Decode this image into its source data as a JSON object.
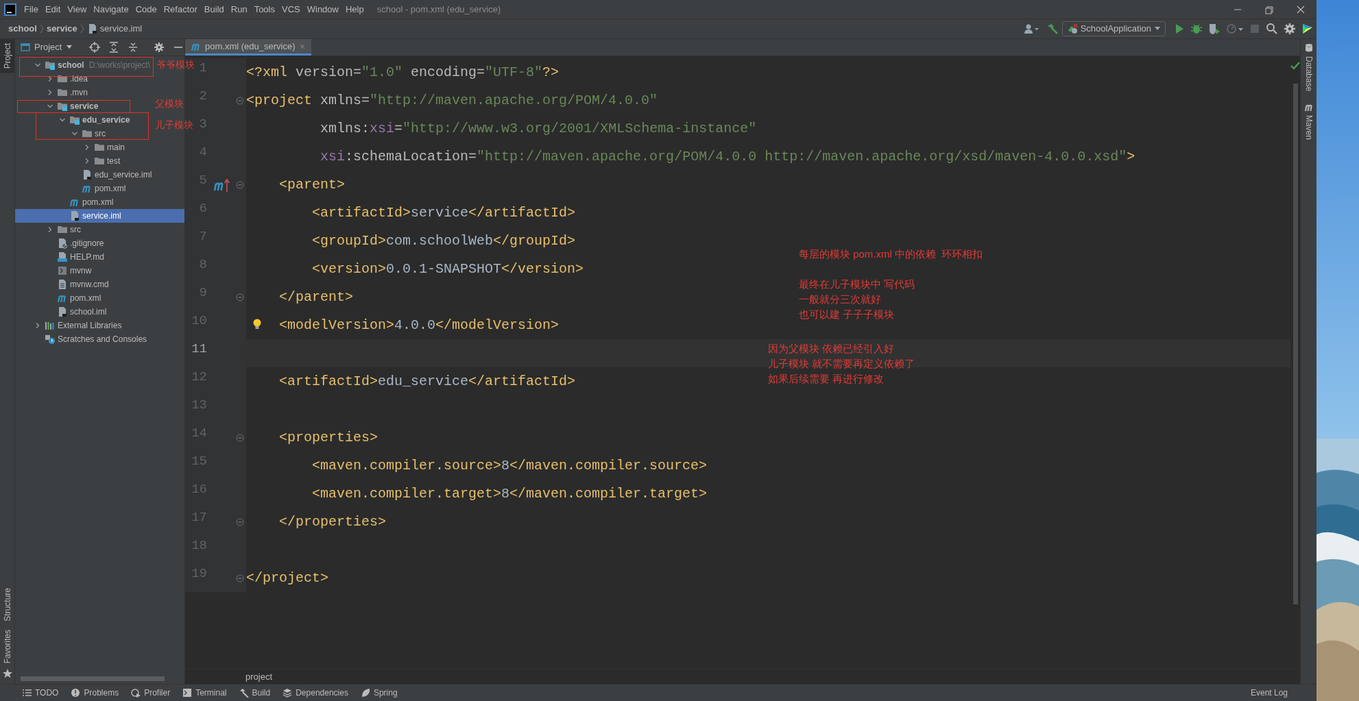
{
  "window": {
    "title": "school - pom.xml (edu_service)",
    "menu": [
      "File",
      "Edit",
      "View",
      "Navigate",
      "Code",
      "Refactor",
      "Build",
      "Run",
      "Tools",
      "VCS",
      "Window",
      "Help"
    ]
  },
  "breadcrumbs": [
    "school",
    "service",
    "service.iml"
  ],
  "toolbar": {
    "run_config": "SchoolApplication"
  },
  "left_stripe": [
    {
      "label": "Project",
      "selected": true
    },
    {
      "label": "Structure",
      "selected": false
    },
    {
      "label": "Favorites",
      "selected": false
    }
  ],
  "project_panel": {
    "title": "Project",
    "tree": [
      {
        "label": "school",
        "kind": "module",
        "bold": true,
        "hint": "D:\\works\\project\\",
        "expanded": true,
        "selected": false,
        "children": [
          {
            "label": ".idea",
            "kind": "folder",
            "bold": false,
            "expanded": false,
            "selected": false
          },
          {
            "label": ".mvn",
            "kind": "folder",
            "bold": false,
            "expanded": false,
            "selected": false
          },
          {
            "label": "service",
            "kind": "module",
            "bold": true,
            "expanded": true,
            "selected": false,
            "children": [
              {
                "label": "edu_service",
                "kind": "module",
                "bold": true,
                "expanded": true,
                "selected": false,
                "children": [
                  {
                    "label": "src",
                    "kind": "folder",
                    "bold": false,
                    "expanded": true,
                    "selected": false,
                    "children": [
                      {
                        "label": "main",
                        "kind": "folder",
                        "bold": false,
                        "expanded": false,
                        "selected": false
                      },
                      {
                        "label": "test",
                        "kind": "folder",
                        "bold": false,
                        "expanded": false,
                        "selected": false
                      }
                    ]
                  },
                  {
                    "label": "edu_service.iml",
                    "kind": "iml",
                    "bold": false,
                    "selected": false
                  },
                  {
                    "label": "pom.xml",
                    "kind": "maven",
                    "bold": false,
                    "selected": false
                  }
                ]
              },
              {
                "label": "pom.xml",
                "kind": "maven",
                "bold": false,
                "selected": false
              },
              {
                "label": "service.iml",
                "kind": "iml",
                "bold": false,
                "selected": true
              }
            ]
          },
          {
            "label": "src",
            "kind": "folder",
            "bold": false,
            "expanded": false,
            "selected": false
          },
          {
            "label": ".gitignore",
            "kind": "gitignore",
            "bold": false,
            "selected": false
          },
          {
            "label": "HELP.md",
            "kind": "md",
            "bold": false,
            "selected": false
          },
          {
            "label": "mvnw",
            "kind": "script",
            "bold": false,
            "selected": false
          },
          {
            "label": "mvnw.cmd",
            "kind": "cmd",
            "bold": false,
            "selected": false
          },
          {
            "label": "pom.xml",
            "kind": "maven",
            "bold": false,
            "selected": false
          },
          {
            "label": "school.iml",
            "kind": "iml",
            "bold": false,
            "selected": false
          }
        ]
      },
      {
        "label": "External Libraries",
        "kind": "libraries",
        "bold": false,
        "expanded": false,
        "selected": false
      },
      {
        "label": "Scratches and Consoles",
        "kind": "scratches",
        "bold": false,
        "selected": false
      }
    ]
  },
  "editor": {
    "tabs": [
      {
        "label": "pom.xml (edu_service)",
        "selected": true
      }
    ],
    "lines": [
      {
        "number": "1",
        "kind": "plain",
        "fold": false,
        "current": false,
        "tokens": [
          {
            "kind": "tag",
            "text": "<?xml"
          },
          {
            "kind": "attr",
            "text": " version="
          },
          {
            "kind": "value",
            "text": "\"1.0\""
          },
          {
            "kind": "attr",
            "text": " encoding="
          },
          {
            "kind": "value",
            "text": "\"UTF-8\""
          },
          {
            "kind": "tag",
            "text": "?>"
          }
        ]
      },
      {
        "number": "2",
        "kind": "plain",
        "fold": true,
        "current": false,
        "tokens": [
          {
            "kind": "tag",
            "text": "<project"
          },
          {
            "kind": "attr",
            "text": " xmlns="
          },
          {
            "kind": "value",
            "text": "\"http://maven.apache.org/POM/4.0.0\""
          }
        ]
      },
      {
        "number": "3",
        "kind": "plain",
        "fold": false,
        "current": false,
        "tokens": [
          {
            "kind": "attr",
            "text": "         xmlns:"
          },
          {
            "kind": "ns",
            "text": "xsi"
          },
          {
            "kind": "attr",
            "text": "="
          },
          {
            "kind": "value",
            "text": "\"http://www.w3.org/2001/XMLSchema-instance\""
          }
        ]
      },
      {
        "number": "4",
        "kind": "plain",
        "fold": false,
        "current": false,
        "tokens": [
          {
            "kind": "ns",
            "text": "         xsi"
          },
          {
            "kind": "attr",
            "text": ":schemaLocation="
          },
          {
            "kind": "value",
            "text": "\"http://maven.apache.org/POM/4.0.0 http://maven.apache.org/xsd/maven-4.0.0.xsd\""
          },
          {
            "kind": "tag",
            "text": ">"
          }
        ]
      },
      {
        "number": "5",
        "kind": "maven",
        "fold": true,
        "current": false,
        "tokens": [
          {
            "kind": "tag",
            "text": "    <parent>"
          }
        ]
      },
      {
        "number": "6",
        "kind": "plain",
        "fold": false,
        "current": false,
        "tokens": [
          {
            "kind": "tag",
            "text": "        <artifactId>"
          },
          {
            "kind": "text",
            "text": "service"
          },
          {
            "kind": "tag",
            "text": "</artifactId>"
          }
        ]
      },
      {
        "number": "7",
        "kind": "plain",
        "fold": false,
        "current": false,
        "tokens": [
          {
            "kind": "tag",
            "text": "        <groupId>"
          },
          {
            "kind": "text",
            "text": "com.schoolWeb"
          },
          {
            "kind": "tag",
            "text": "</groupId>"
          }
        ]
      },
      {
        "number": "8",
        "kind": "plain",
        "fold": false,
        "current": false,
        "tokens": [
          {
            "kind": "tag",
            "text": "        <version>"
          },
          {
            "kind": "text",
            "text": "0.0.1-SNAPSHOT"
          },
          {
            "kind": "tag",
            "text": "</version>"
          }
        ]
      },
      {
        "number": "9",
        "kind": "plain",
        "fold": true,
        "current": false,
        "tokens": [
          {
            "kind": "tag",
            "text": "    </parent>"
          }
        ]
      },
      {
        "number": "10",
        "kind": "bulb",
        "fold": false,
        "current": false,
        "tokens": [
          {
            "kind": "tag",
            "text": "    <modelVersion>"
          },
          {
            "kind": "text",
            "text": "4.0.0"
          },
          {
            "kind": "tag",
            "text": "</modelVersion>"
          }
        ]
      },
      {
        "number": "11",
        "kind": "plain",
        "fold": false,
        "current": true
      },
      {
        "number": "12",
        "kind": "plain",
        "fold": false,
        "current": false,
        "tokens": [
          {
            "kind": "tag",
            "text": "    <artifactId>"
          },
          {
            "kind": "text",
            "text": "edu_service"
          },
          {
            "kind": "tag",
            "text": "</artifactId>"
          }
        ]
      },
      {
        "number": "13",
        "kind": "plain",
        "fold": false,
        "current": false
      },
      {
        "number": "14",
        "kind": "plain",
        "fold": true,
        "current": false,
        "tokens": [
          {
            "kind": "tag",
            "text": "    <properties>"
          }
        ]
      },
      {
        "number": "15",
        "kind": "plain",
        "fold": false,
        "current": false,
        "tokens": [
          {
            "kind": "tag",
            "text": "        <maven.compiler.source>"
          },
          {
            "kind": "text",
            "text": "8"
          },
          {
            "kind": "tag",
            "text": "</maven.compiler.source>"
          }
        ]
      },
      {
        "number": "16",
        "kind": "plain",
        "fold": false,
        "current": false,
        "tokens": [
          {
            "kind": "tag",
            "text": "        <maven.compiler.target>"
          },
          {
            "kind": "text",
            "text": "8"
          },
          {
            "kind": "tag",
            "text": "</maven.compiler.target>"
          }
        ]
      },
      {
        "number": "17",
        "kind": "plain",
        "fold": true,
        "current": false,
        "tokens": [
          {
            "kind": "tag",
            "text": "    </properties>"
          }
        ]
      },
      {
        "number": "18",
        "kind": "plain",
        "fold": false,
        "current": false
      },
      {
        "number": "19",
        "kind": "plain",
        "fold": true,
        "current": false,
        "tokens": [
          {
            "kind": "tag",
            "text": "</project>"
          }
        ]
      }
    ],
    "breadcrumb": "project"
  },
  "right_stripe": [
    "Database",
    "Maven"
  ],
  "bottom_tools": [
    {
      "label": "TODO",
      "kind": "list"
    },
    {
      "label": "Problems",
      "kind": "problems"
    },
    {
      "label": "Profiler",
      "kind": "profiler"
    },
    {
      "label": "Terminal",
      "kind": "terminal"
    },
    {
      "label": "Build",
      "kind": "build"
    },
    {
      "label": "Dependencies",
      "kind": "dependencies"
    },
    {
      "label": "Spring",
      "kind": "spring"
    }
  ],
  "event_log": "Event Log",
  "annotations": {
    "tree_notes": [
      "爷爷模块",
      "父模块",
      "儿子模块"
    ],
    "editor_notes": [
      [
        "每层的模块 pom.xml 中的依赖  环环相扣"
      ],
      [
        "最终在儿子模块中 写代码",
        "一般就分三次就好",
        "也可以建 子子子模块"
      ],
      [
        "因为父模块 依赖已经引入好",
        "儿子模块 就不需要再定义依赖了",
        "如果后续需要 再进行修改"
      ]
    ]
  },
  "desktop": {
    "kind": "picture"
  }
}
